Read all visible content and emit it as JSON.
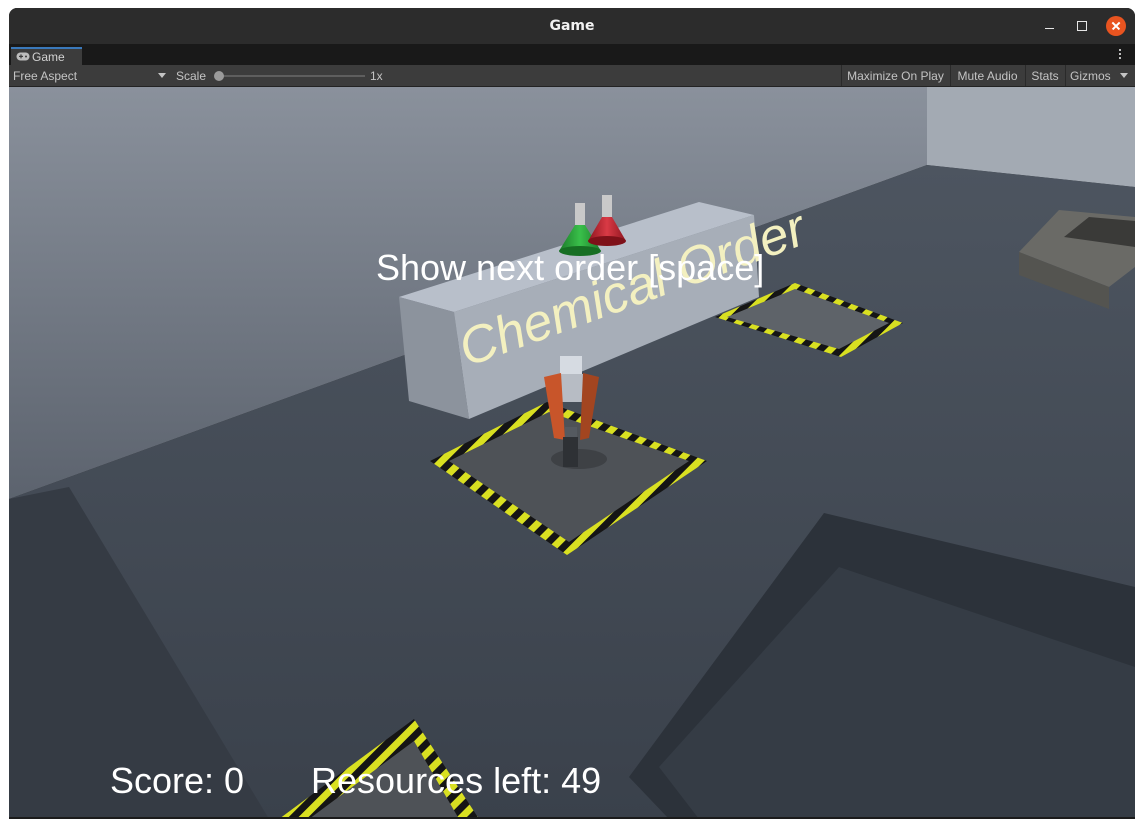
{
  "window": {
    "title": "Game"
  },
  "tabs": [
    {
      "label": "Game",
      "icon": "gamepad-icon",
      "active": true
    }
  ],
  "toolbar": {
    "aspect": "Free Aspect",
    "scale_label": "Scale",
    "scale_value": "1x",
    "maximize_on_play": "Maximize On Play",
    "mute_audio": "Mute Audio",
    "stats": "Stats",
    "gizmos": "Gizmos"
  },
  "scene": {
    "counter_sign": "Chemical Order",
    "prompt": "Show next order [space]",
    "score": "Score: 0",
    "resources_left": "Resources left: 49"
  },
  "colors": {
    "accent": "#3a79bb",
    "close_button": "#e95420",
    "hazard_yellow": "#d9e021",
    "flask_green": "#2aa13a",
    "flask_red": "#c7202a"
  }
}
